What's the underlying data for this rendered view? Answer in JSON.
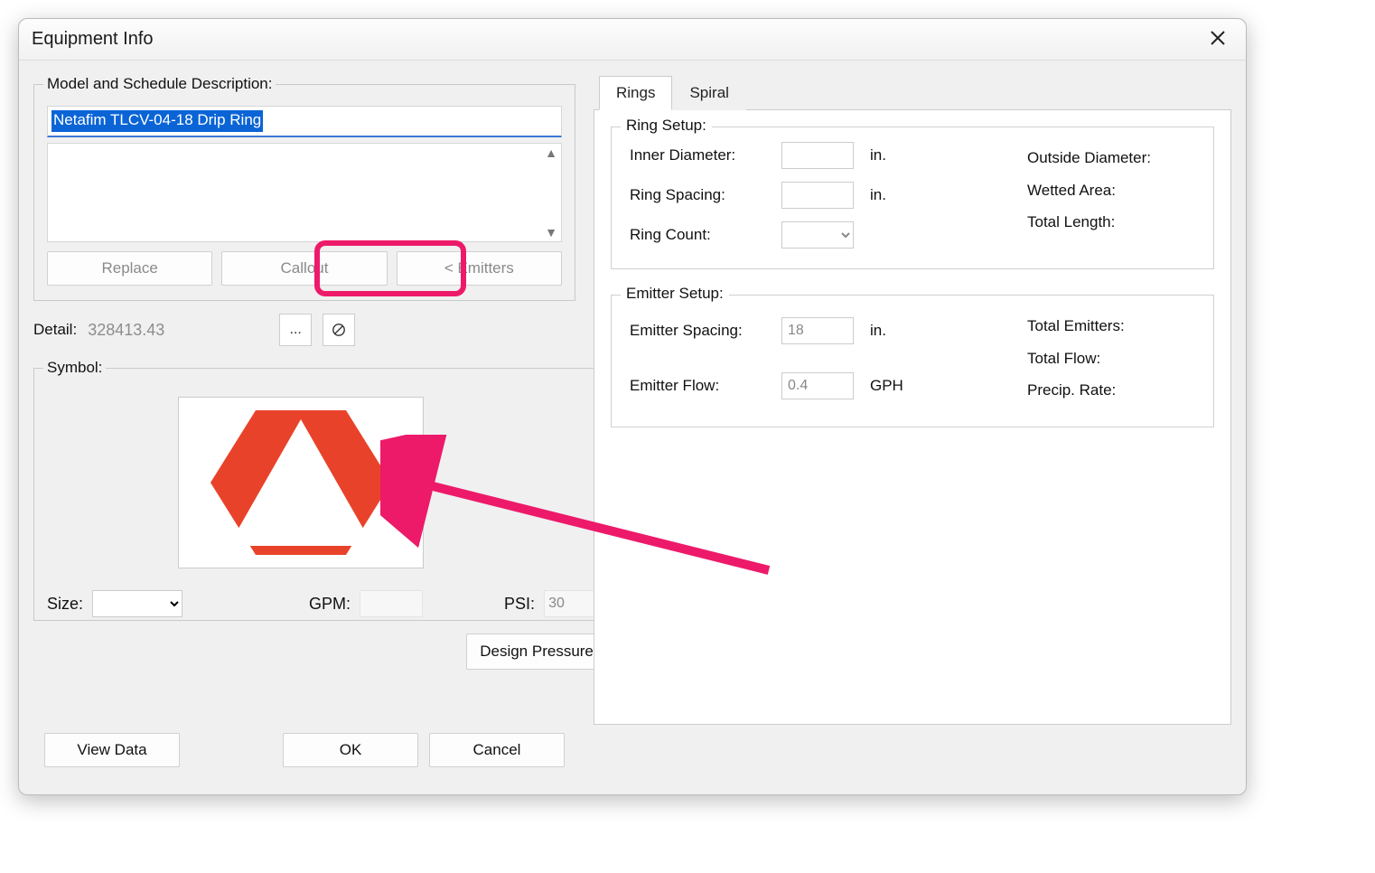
{
  "dialog": {
    "title": "Equipment Info"
  },
  "left": {
    "model_label": "Model and Schedule Description:",
    "model_value": "Netafim TLCV-04-18 Drip Ring",
    "buttons": {
      "replace": "Replace",
      "callout": "Callout",
      "emitters": "< Emitters"
    },
    "detail_label": "Detail:",
    "detail_value": "328413.43",
    "detail_browse": "...",
    "symbol_label": "Symbol:",
    "size_label": "Size:",
    "gpm_label": "GPM:",
    "gpm_value": "",
    "psi_label": "PSI:",
    "psi_value": "30",
    "design_pressure": "Design Pressure",
    "view_data": "View Data",
    "ok": "OK",
    "cancel": "Cancel"
  },
  "tabs": {
    "rings": "Rings",
    "spiral": "Spiral"
  },
  "ring_setup": {
    "legend": "Ring Setup:",
    "inner_diameter_label": "Inner Diameter:",
    "inner_diameter_value": "",
    "inner_diameter_unit": "in.",
    "ring_spacing_label": "Ring Spacing:",
    "ring_spacing_value": "",
    "ring_spacing_unit": "in.",
    "ring_count_label": "Ring Count:",
    "outside_diameter_label": "Outside Diameter:",
    "wetted_area_label": "Wetted Area:",
    "total_length_label": "Total Length:"
  },
  "emitter_setup": {
    "legend": "Emitter Setup:",
    "spacing_label": "Emitter Spacing:",
    "spacing_value": "18",
    "spacing_unit": "in.",
    "flow_label": "Emitter Flow:",
    "flow_value": "0.4",
    "flow_unit": "GPH",
    "total_emitters_label": "Total Emitters:",
    "total_flow_label": "Total Flow:",
    "precip_rate_label": "Precip. Rate:"
  }
}
